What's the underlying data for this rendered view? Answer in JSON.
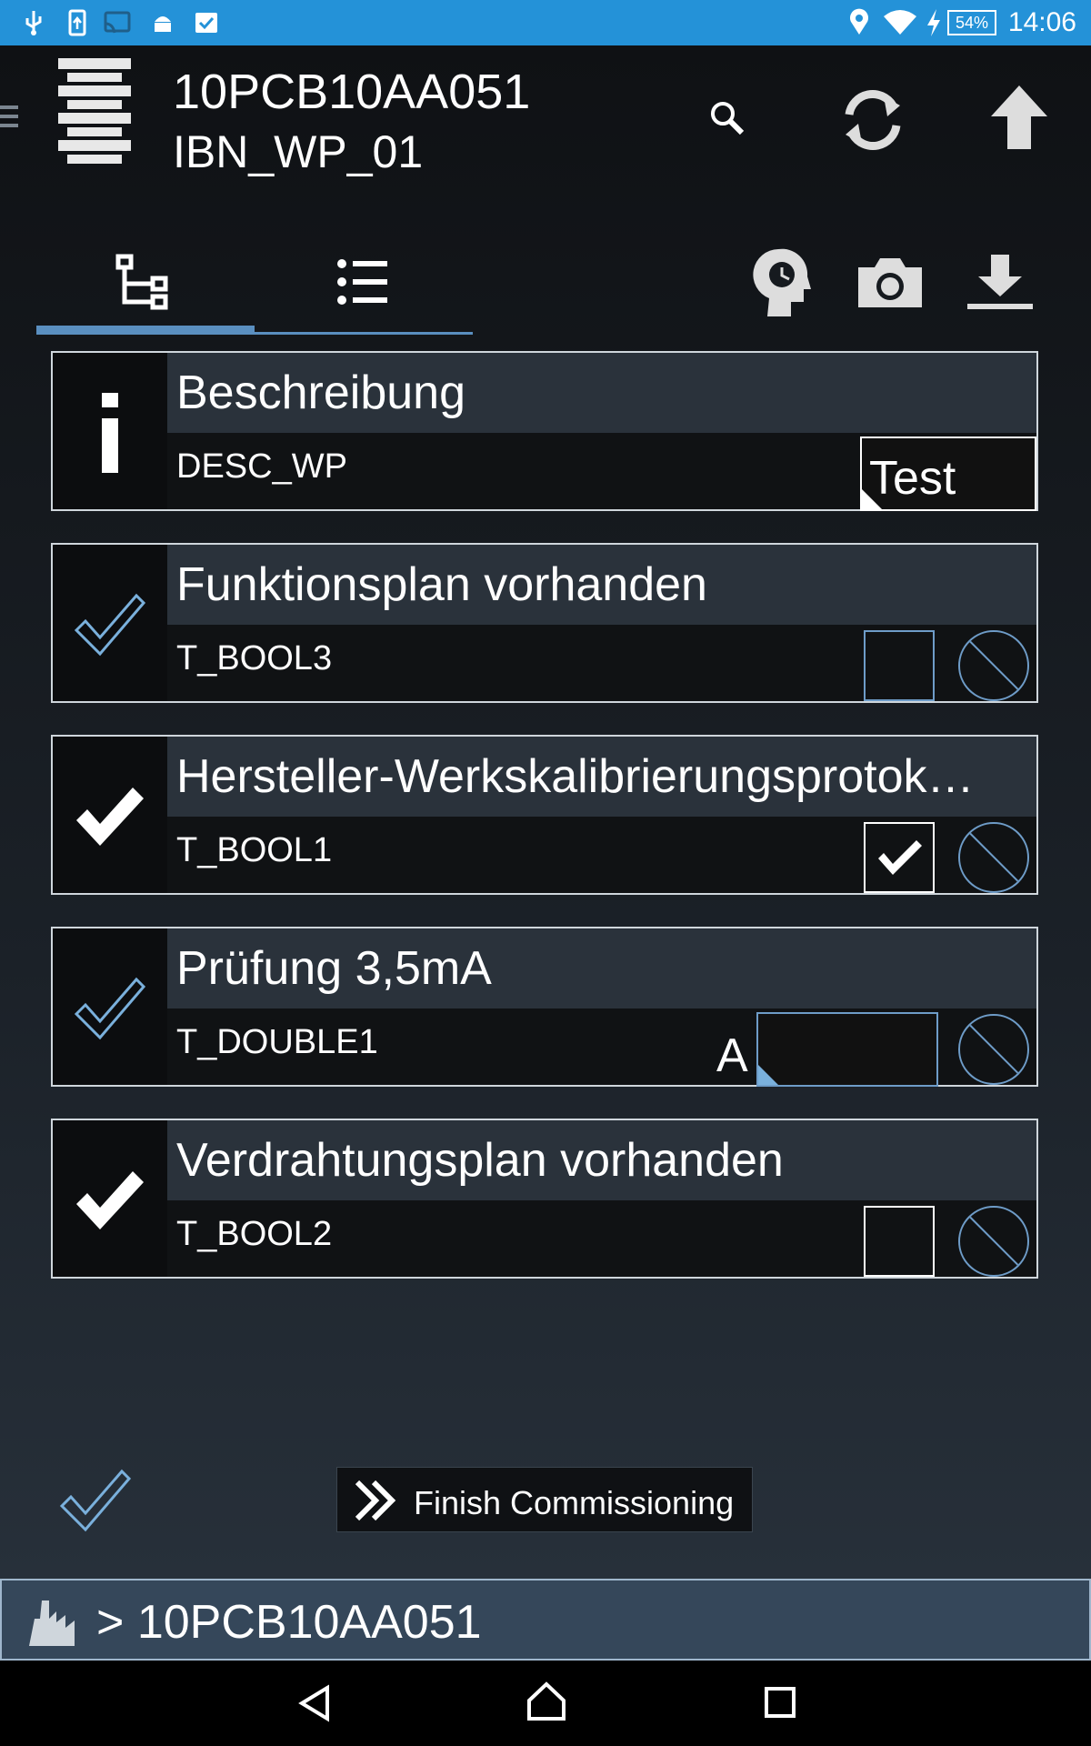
{
  "status_bar": {
    "time": "14:06",
    "battery": "54%"
  },
  "header": {
    "title": "10PCB10AA051",
    "subtitle": "IBN_WP_01"
  },
  "items": [
    {
      "title": "Beschreibung",
      "code": "DESC_WP",
      "value": "Test"
    },
    {
      "title": "Funktionsplan vorhanden",
      "code": "T_BOOL3"
    },
    {
      "title": "Hersteller-Werkskalibrierungsprotok…",
      "code": "T_BOOL1"
    },
    {
      "title": "Prüfung 3,5mA",
      "code": "T_DOUBLE1",
      "unit": "A"
    },
    {
      "title": "Verdrahtungsplan vorhanden",
      "code": "T_BOOL2"
    }
  ],
  "footer": {
    "finish_label": "Finish Commissioning",
    "breadcrumb": "> 10PCB10AA051"
  },
  "colors": {
    "status_bar": "#2492d8",
    "accent": "#5a8fc0",
    "card_header": "#2a323b",
    "breadcrumb_bg": "#35475a"
  }
}
